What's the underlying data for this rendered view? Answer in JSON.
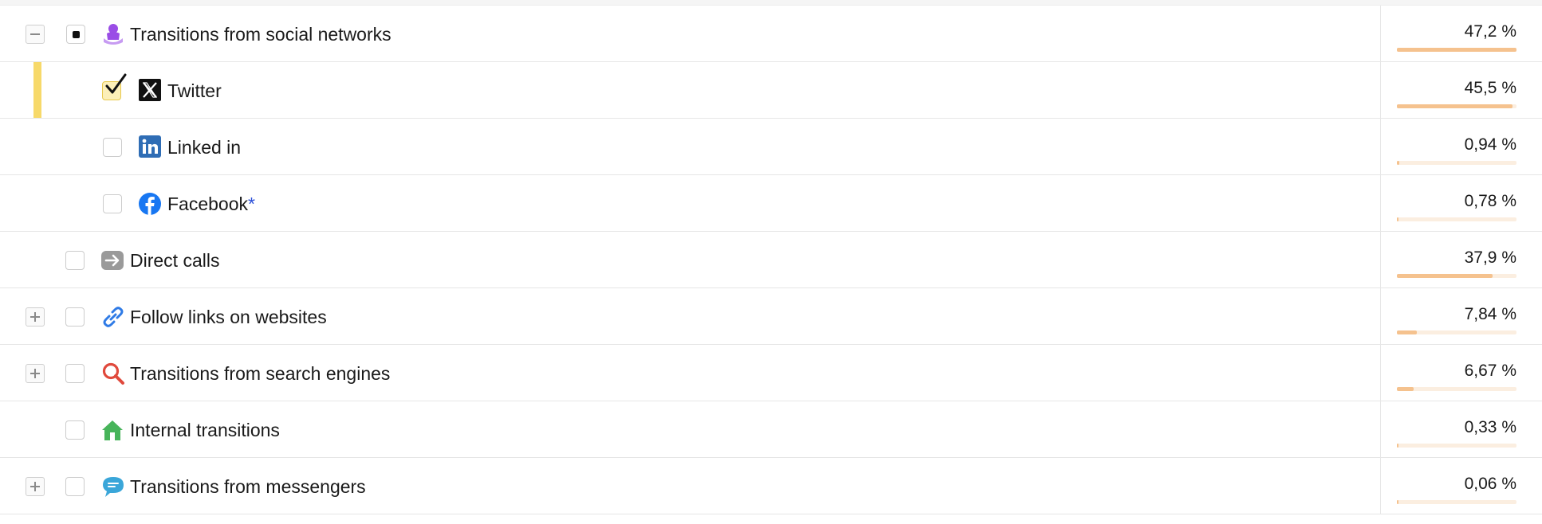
{
  "rows": [
    {
      "label": "Transitions from social networks",
      "percent": "47,2 %",
      "share": 0.472,
      "level": 0,
      "expander": "minus",
      "checkbox": "partial",
      "icon": "user-purple-icon"
    },
    {
      "label": "Twitter",
      "percent": "45,5 %",
      "share": 0.455,
      "level": 1,
      "expander": null,
      "checkbox": "checked",
      "icon": "x-twitter-icon",
      "selected": true
    },
    {
      "label": "Linked in",
      "percent": "0,94 %",
      "share": 0.0094,
      "level": 1,
      "expander": null,
      "checkbox": "unchecked",
      "icon": "linkedin-icon"
    },
    {
      "label": "Facebook",
      "suffix": "*",
      "percent": "0,78 %",
      "share": 0.0078,
      "level": 1,
      "expander": null,
      "checkbox": "unchecked",
      "icon": "facebook-icon"
    },
    {
      "label": "Direct calls",
      "percent": "37,9 %",
      "share": 0.379,
      "level": 0,
      "expander": null,
      "checkbox": "unchecked",
      "icon": "arrow-right-icon"
    },
    {
      "label": "Follow links on websites",
      "percent": "7,84 %",
      "share": 0.0784,
      "level": 0,
      "expander": "plus",
      "checkbox": "unchecked",
      "icon": "link-icon"
    },
    {
      "label": "Transitions from search engines",
      "percent": "6,67 %",
      "share": 0.0667,
      "level": 0,
      "expander": "plus",
      "checkbox": "unchecked",
      "icon": "magnifier-icon"
    },
    {
      "label": "Internal transitions",
      "percent": "0,33 %",
      "share": 0.0033,
      "level": 0,
      "expander": null,
      "checkbox": "unchecked",
      "icon": "house-icon"
    },
    {
      "label": "Transitions from messengers",
      "percent": "0,06 %",
      "share": 0.0006,
      "level": 0,
      "expander": "plus",
      "checkbox": "unchecked",
      "icon": "chat-bubble-icon"
    }
  ],
  "colors": {
    "bar_fill": "#f5c28e",
    "bar_track": "#fbeee0",
    "selection_marker": "#f7d96a",
    "asterisk": "#2b4fd8"
  }
}
